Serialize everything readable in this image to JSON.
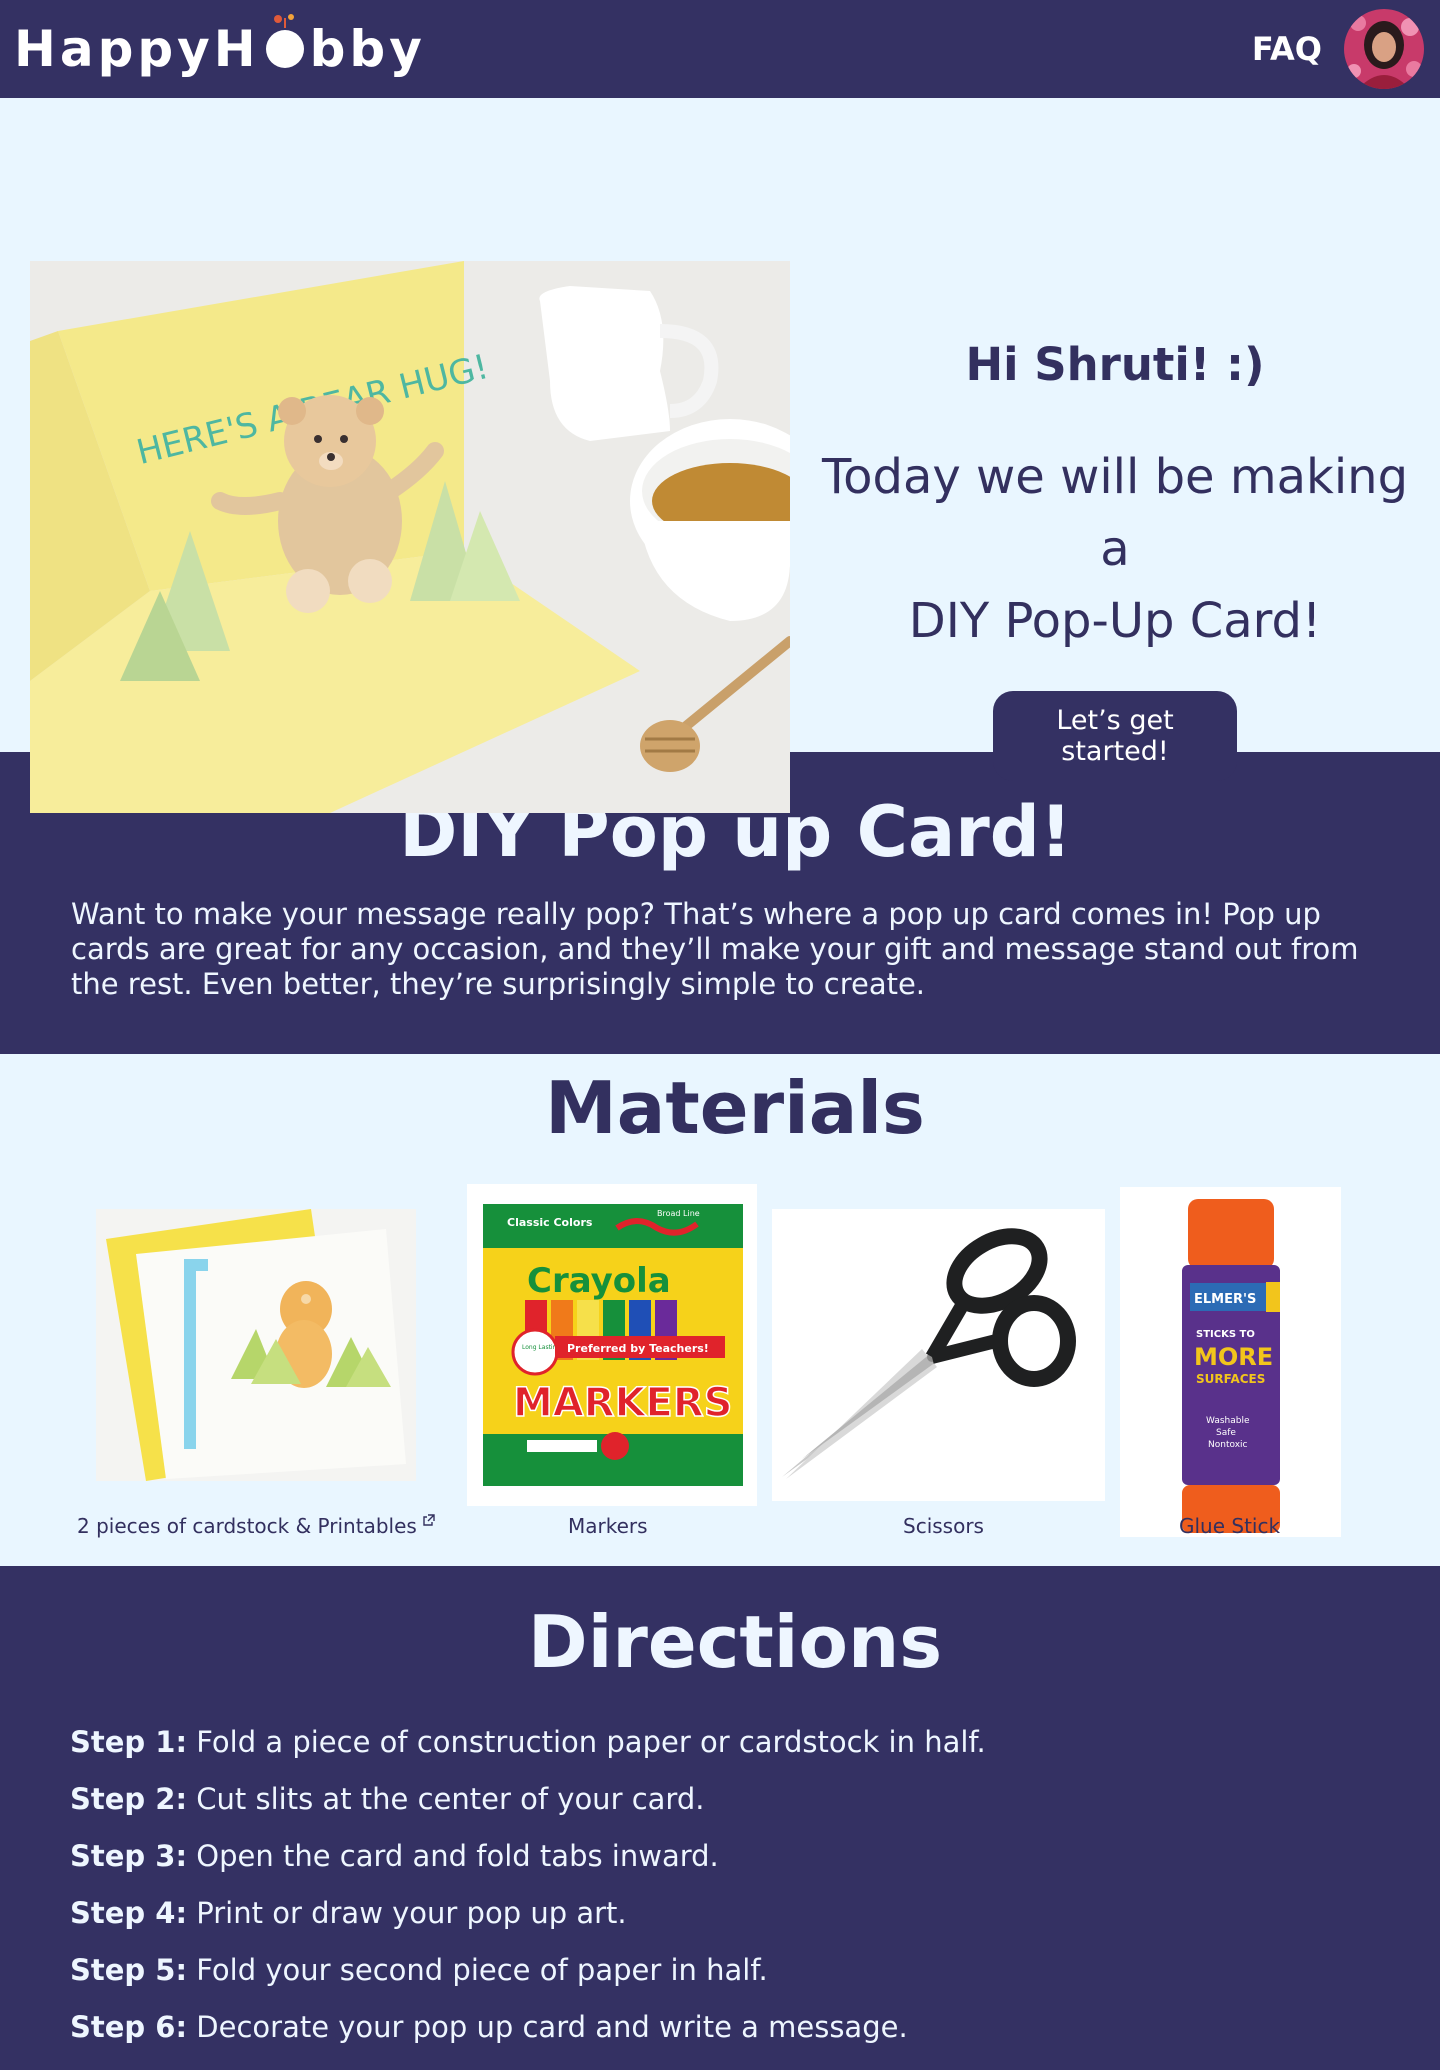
{
  "nav": {
    "logo_left": "HappyH",
    "logo_right": "bby",
    "faq_label": "FAQ"
  },
  "hero": {
    "image_text": "HERE'S A BEAR HUG!",
    "greeting": "Hi Shruti! :)",
    "intro_line1": "Today we will be making a",
    "intro_line2": "DIY Pop-Up Card!",
    "cta_label": "Let’s get started!"
  },
  "about": {
    "title": "DIY Pop up Card!",
    "description": "Want to make your message really pop? That’s where a pop up card comes in! Pop up cards are great for any occasion, and they’ll make your gift and message stand out from the rest. Even better, they’re surprisingly simple to create."
  },
  "materials": {
    "title": "Materials",
    "items": [
      {
        "label": "2 pieces of cardstock & Printables",
        "external_link_icon": "external-link-icon"
      },
      {
        "label": "Markers"
      },
      {
        "label": "Scissors"
      },
      {
        "label": "Glue Stick"
      }
    ],
    "marker_box": {
      "top_left": "Classic Colors",
      "top_right": "Broad Line",
      "brand": "Crayola",
      "badge": "Long Lasting, Brilliant Colors",
      "banner": "Preferred by Teachers!",
      "product": "MARKERS"
    },
    "glue_stick": {
      "brand": "ELMER'S",
      "line1": "STICKS TO",
      "line2": "MORE",
      "line3": "SURFACES",
      "line4": "Washable",
      "line5": "Safe",
      "line6": "Nontoxic"
    }
  },
  "directions": {
    "title": "Directions",
    "steps": [
      {
        "label": "Step 1:",
        "text": " Fold a piece of construction paper or cardstock in half."
      },
      {
        "label": "Step 2:",
        "text": " Cut slits at the center of your card."
      },
      {
        "label": "Step 3:",
        "text": " Open the card and fold tabs inward."
      },
      {
        "label": "Step 4:",
        "text": " Print or draw your pop up art."
      },
      {
        "label": "Step 5:",
        "text": " Fold your second piece of paper in half."
      },
      {
        "label": "Step 6:",
        "text": " Decorate your pop up card and write a message."
      }
    ]
  },
  "colors": {
    "navy": "#343163",
    "light_bg": "#e9f6ff",
    "text_dark": "#33305f"
  }
}
